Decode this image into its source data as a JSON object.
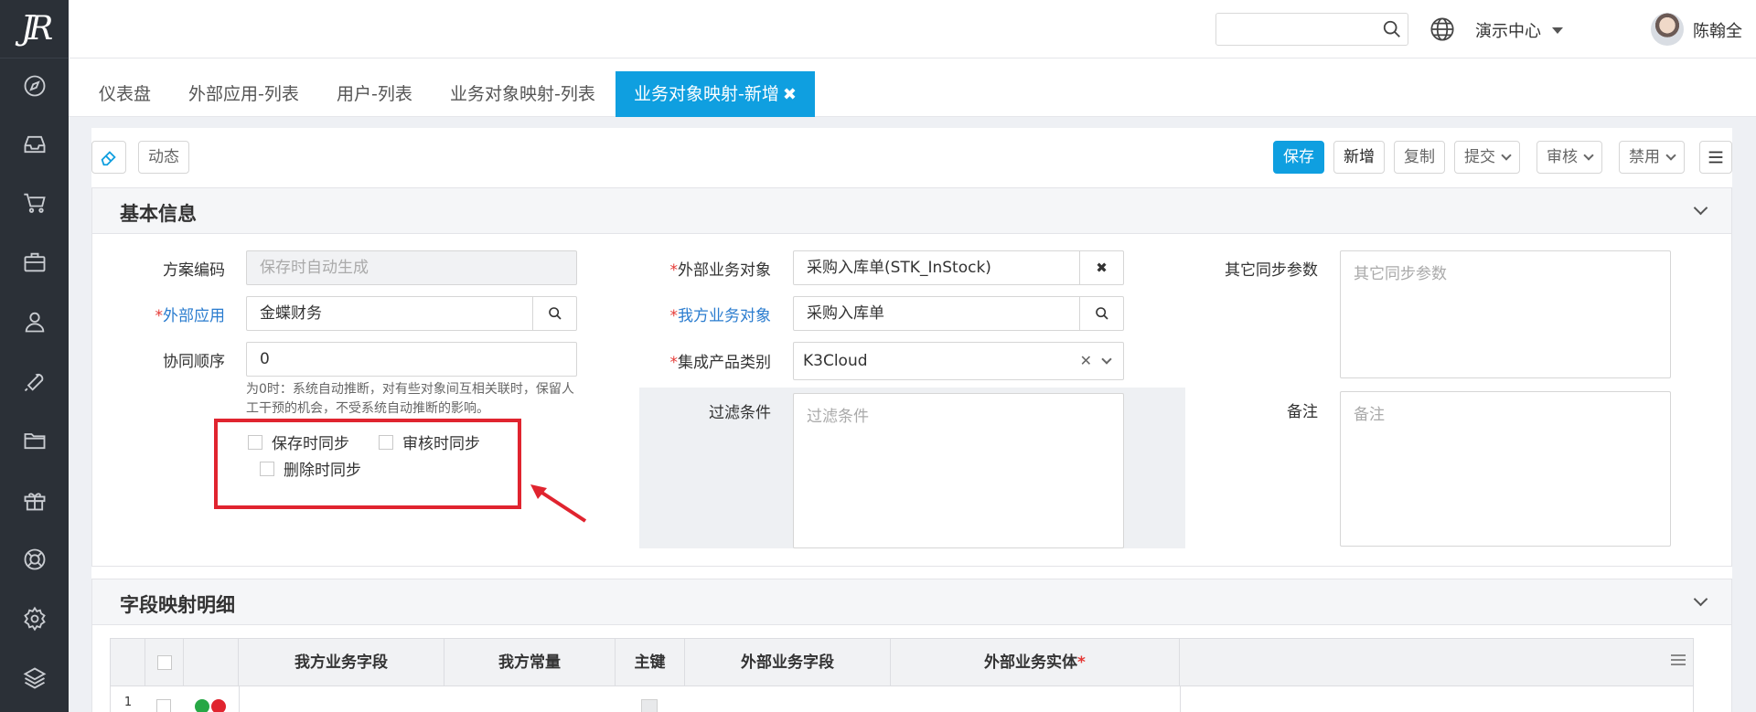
{
  "sidebar": {
    "logo_text": "JR",
    "icons": [
      "compass-icon",
      "inbox-icon",
      "cart-icon",
      "briefcase-icon",
      "user-icon",
      "wrench-icon",
      "folder-icon",
      "gift-icon",
      "lifebuoy-icon",
      "gear-icon",
      "layers-icon"
    ]
  },
  "header": {
    "search_placeholder": "",
    "demo_center": "演示中心",
    "user_name": "陈翰全"
  },
  "tabs": [
    {
      "label": "仪表盘"
    },
    {
      "label": "外部应用-列表"
    },
    {
      "label": "用户-列表"
    },
    {
      "label": "业务对象映射-列表"
    },
    {
      "label": "业务对象映射-新增",
      "close": "✖"
    }
  ],
  "toolbar": {
    "dynamic": "动态",
    "save": "保存",
    "add": "新增",
    "copy": "复制",
    "submit": "提交",
    "audit": "审核",
    "disable": "禁用"
  },
  "basic": {
    "title": "基本信息",
    "scheme_code_label": "方案编码",
    "scheme_code_placeholder": "保存时自动生成",
    "ext_app_label": "外部应用",
    "ext_app_value": "金蝶财务",
    "sync_order_label": "协同顺序",
    "sync_order_value": "0",
    "hint": "为0时：系统自动推断，对有些对象间互相关联时，保留人工干预的机会，不受系统自动推断的影响。",
    "cb_save": "保存时同步",
    "cb_audit": "审核时同步",
    "cb_delete": "删除时同步",
    "ext_obj_label": "外部业务对象",
    "ext_obj_value": "采购入库单(STK_InStock)",
    "my_obj_label": "我方业务对象",
    "my_obj_value": "采购入库单",
    "product_label": "集成产品类别",
    "product_value": "K3Cloud",
    "filter_label": "过滤条件",
    "filter_placeholder": "过滤条件",
    "other_label": "其它同步参数",
    "other_placeholder": "其它同步参数",
    "remark_label": "备注",
    "remark_placeholder": "备注"
  },
  "mapping": {
    "title": "字段映射明细",
    "columns": [
      "我方业务字段",
      "我方常量",
      "主键",
      "外部业务字段",
      "外部业务实体"
    ],
    "first_row_no": "1"
  },
  "colors": {
    "primary": "#0f9fe0",
    "sidebar": "#2b3037",
    "required": "#e53935",
    "annotation": "#e0242f"
  }
}
